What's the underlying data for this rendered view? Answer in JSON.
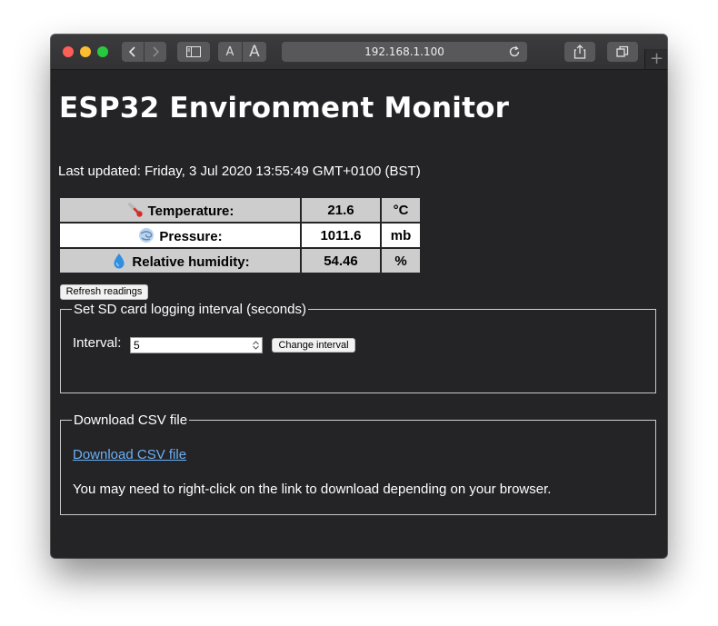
{
  "browser": {
    "address": "192.168.1.100",
    "font_small_label": "A",
    "font_large_label": "A",
    "new_tab_label": "+"
  },
  "page": {
    "title": "ESP32 Environment Monitor",
    "last_updated": "Last updated: Friday, 3 Jul 2020 13:55:49 GMT+0100 (BST)",
    "readings": [
      {
        "label": "Temperature:",
        "value": "21.6",
        "unit": "°C",
        "icon": "thermometer-icon"
      },
      {
        "label": "Pressure:",
        "value": "1011.6",
        "unit": "mb",
        "icon": "wind-icon"
      },
      {
        "label": "Relative humidity:",
        "value": "54.46",
        "unit": "%",
        "icon": "droplet-icon"
      }
    ],
    "refresh_button": "Refresh readings",
    "logging": {
      "legend": "Set SD card logging interval (seconds)",
      "interval_label": "Interval:",
      "interval_value": "5",
      "change_button": "Change interval"
    },
    "download": {
      "legend": "Download CSV file",
      "link_text": "Download CSV file",
      "note": "You may need to right-click on the link to download depending on your browser."
    }
  },
  "colors": {
    "page_background": "#242427",
    "link": "#6ab0f3",
    "table_shaded": "#cdcdcd",
    "table_plain": "#ffffff"
  }
}
